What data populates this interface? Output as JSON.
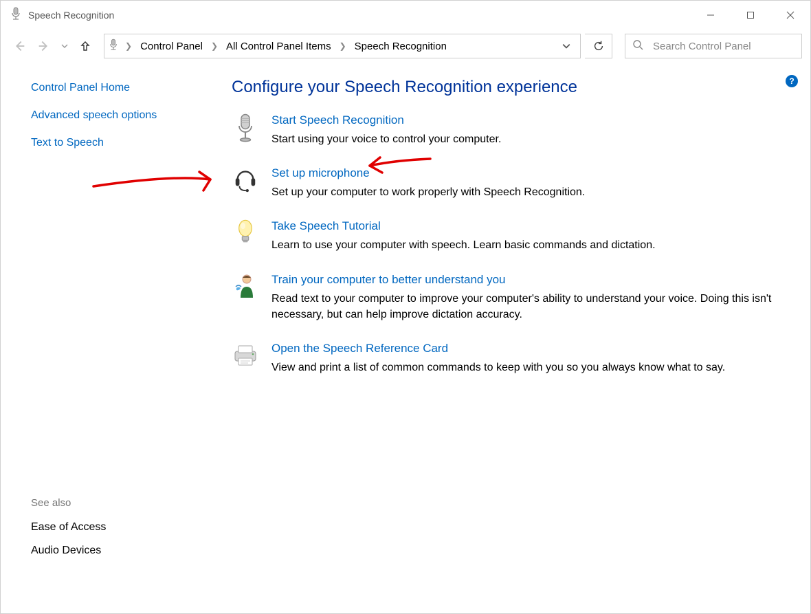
{
  "window": {
    "title": "Speech Recognition"
  },
  "toolbar": {
    "breadcrumbs": [
      "Control Panel",
      "All Control Panel Items",
      "Speech Recognition"
    ],
    "search_placeholder": "Search Control Panel"
  },
  "sidebar": {
    "links": [
      {
        "label": "Control Panel Home"
      },
      {
        "label": "Advanced speech options"
      },
      {
        "label": "Text to Speech"
      }
    ],
    "see_also_label": "See also",
    "see_also": [
      {
        "label": "Ease of Access"
      },
      {
        "label": "Audio Devices"
      }
    ]
  },
  "main": {
    "heading": "Configure your Speech Recognition experience",
    "items": [
      {
        "title": "Start Speech Recognition",
        "desc": "Start using your voice to control your computer.",
        "icon": "microphone-icon"
      },
      {
        "title": "Set up microphone",
        "desc": "Set up your computer to work properly with Speech Recognition.",
        "icon": "headset-icon"
      },
      {
        "title": "Take Speech Tutorial",
        "desc": "Learn to use your computer with speech.  Learn basic commands and dictation.",
        "icon": "lightbulb-icon"
      },
      {
        "title": "Train your computer to better understand you",
        "desc": "Read text to your computer to improve your computer's ability to understand your voice. Doing this isn't necessary, but can help improve dictation accuracy.",
        "icon": "person-icon"
      },
      {
        "title": "Open the Speech Reference Card",
        "desc": "View and print a list of common commands to keep with you so you always know what to say.",
        "icon": "printer-icon"
      }
    ]
  },
  "help_tooltip": "?"
}
